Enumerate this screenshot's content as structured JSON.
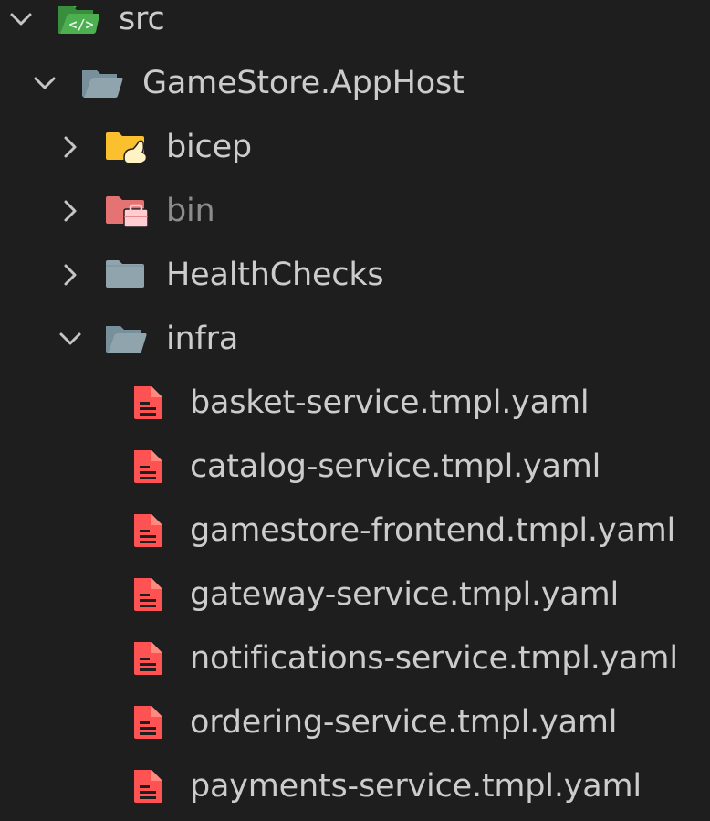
{
  "colors": {
    "background": "#1e1e1e",
    "text": "#cccccc",
    "text_dimmed": "#8c8c8c",
    "chevron": "#c5c5c5",
    "folder_src": "#4caf50",
    "folder_default": "#90a4ae",
    "folder_bicep": "#fbc02d",
    "folder_bin": "#e57373",
    "file_yaml": "#ff5252"
  },
  "tree": {
    "root": {
      "label": "src",
      "expanded": true,
      "icon": "folder-src-open-icon"
    },
    "project": {
      "label": "GameStore.AppHost",
      "expanded": true,
      "icon": "folder-open-icon"
    },
    "folders": [
      {
        "label": "bicep",
        "expanded": false,
        "icon": "folder-bicep-icon",
        "dimmed": false
      },
      {
        "label": "bin",
        "expanded": false,
        "icon": "folder-bin-icon",
        "dimmed": true
      },
      {
        "label": "HealthChecks",
        "expanded": false,
        "icon": "folder-closed-icon",
        "dimmed": false
      },
      {
        "label": "infra",
        "expanded": true,
        "icon": "folder-open-icon",
        "dimmed": false
      }
    ],
    "files": [
      {
        "label": "basket-service.tmpl.yaml",
        "icon": "yaml-file-icon"
      },
      {
        "label": "catalog-service.tmpl.yaml",
        "icon": "yaml-file-icon"
      },
      {
        "label": "gamestore-frontend.tmpl.yaml",
        "icon": "yaml-file-icon"
      },
      {
        "label": "gateway-service.tmpl.yaml",
        "icon": "yaml-file-icon"
      },
      {
        "label": "notifications-service.tmpl.yaml",
        "icon": "yaml-file-icon"
      },
      {
        "label": "ordering-service.tmpl.yaml",
        "icon": "yaml-file-icon"
      },
      {
        "label": "payments-service.tmpl.yaml",
        "icon": "yaml-file-icon"
      }
    ]
  }
}
